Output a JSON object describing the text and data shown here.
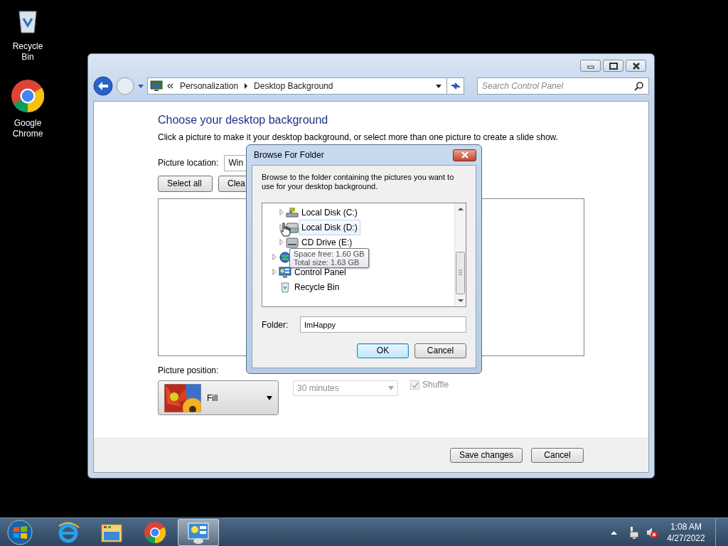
{
  "desktop_icons": [
    {
      "kind": "recycle-bin",
      "label": "Recycle Bin"
    },
    {
      "kind": "chrome",
      "label": "Google Chrome"
    }
  ],
  "window": {
    "breadcrumbs": [
      "Personalization",
      "Desktop Background"
    ],
    "search": {
      "placeholder": "Search Control Panel"
    },
    "heading": "Choose your desktop background",
    "description": "Click a picture to make it your desktop background, or select more than one picture to create a slide show.",
    "picture_location": {
      "label": "Picture location:",
      "value": "Win"
    },
    "buttons": [
      "Select all",
      "Clea"
    ],
    "picture_position": {
      "label": "Picture position:",
      "value": "Fill"
    },
    "interval": {
      "value": "30 minutes",
      "disabled": true
    },
    "shuffle": {
      "label": "Shuffle",
      "checked": true,
      "disabled": true
    },
    "footer_buttons": [
      "Save changes",
      "Cancel"
    ]
  },
  "dialog": {
    "title": "Browse For Folder",
    "instruction": "Browse to the folder containing the pictures you want to use for your desktop background.",
    "tree": [
      {
        "kind": "group",
        "children": [
          {
            "kind": "system-drive",
            "label": "Local Disk (C:)",
            "expandable": true,
            "hovered": false
          },
          {
            "kind": "drive",
            "label": "Local Disk (D:)",
            "expandable": true,
            "hovered": true
          },
          {
            "kind": "cd-drive",
            "label": "CD Drive (E:)",
            "expandable": true,
            "hovered": false
          }
        ]
      },
      {
        "kind": "network",
        "expandable": true,
        "hovered": false
      },
      {
        "kind": "control-panel",
        "label": "Control Panel",
        "expandable": true,
        "hovered": false
      },
      {
        "kind": "recycle-bin",
        "label": "Recycle Bin",
        "expandable": false,
        "hovered": false
      }
    ],
    "tooltip": [
      "Space free: 1.60 GB",
      "Total size: 1.63 GB"
    ],
    "folder": {
      "label": "Folder:",
      "value": "ImHappy"
    },
    "buttons": [
      {
        "label": "OK",
        "default": true
      },
      {
        "label": "Cancel",
        "default": false
      }
    ]
  },
  "taskbar": {
    "items": [
      {
        "kind": "start",
        "active": false
      },
      {
        "kind": "ie",
        "active": false
      },
      {
        "kind": "explorer",
        "active": false
      },
      {
        "kind": "chrome",
        "active": false
      },
      {
        "kind": "control-panel",
        "active": true
      }
    ],
    "time": "1:08 AM",
    "date": "4/27/2022"
  }
}
